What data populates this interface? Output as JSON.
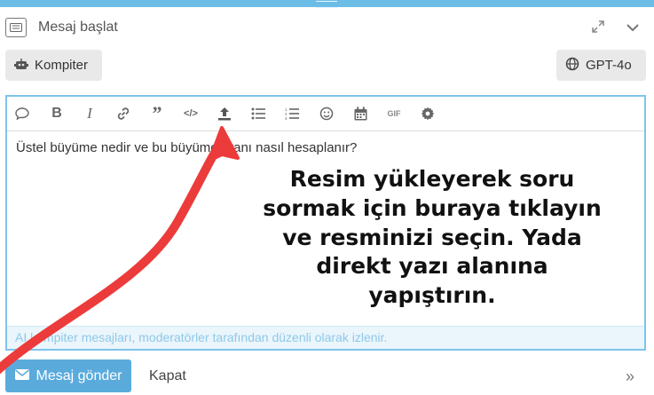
{
  "header": {
    "title": "Mesaj başlat",
    "icons": {
      "compose": "keyboard-icon",
      "expand": "expand-icon",
      "collapse": "chevron-down-icon"
    }
  },
  "chips": {
    "left": {
      "label": "Kompiter",
      "icon": "robot-icon"
    },
    "right": {
      "label": "GPT-4o",
      "icon": "globe-icon"
    }
  },
  "toolbar": {
    "gif_label": "GIF",
    "items": [
      "speech-bubble-icon",
      "bold-icon",
      "italic-icon",
      "link-icon",
      "quote-icon",
      "code-icon",
      "upload-icon",
      "bullet-list-icon",
      "numbered-list-icon",
      "emoji-icon",
      "calendar-icon",
      "gif-icon",
      "gear-icon"
    ]
  },
  "editor": {
    "value": "Üstel büyüme nedir ve bu büyüme oranı nasıl hesaplanır?",
    "notice": "AI kompiter mesajları, moderatörler tarafından düzenli olarak izlenir."
  },
  "footer": {
    "send_label": "Mesaj gönder",
    "close_label": "Kapat",
    "more_label": "»"
  },
  "annotation": {
    "lines": [
      "Resim yükleyerek soru",
      "sormak için buraya tıklayın",
      "ve resminizi seçin. Yada",
      "direkt yazı alanına",
      "yapıştırın."
    ],
    "arrow_color": "#ec3b3b"
  },
  "colors": {
    "accent": "#5aabdc",
    "topbar": "#6cbde6",
    "border": "#7ec4ea"
  }
}
